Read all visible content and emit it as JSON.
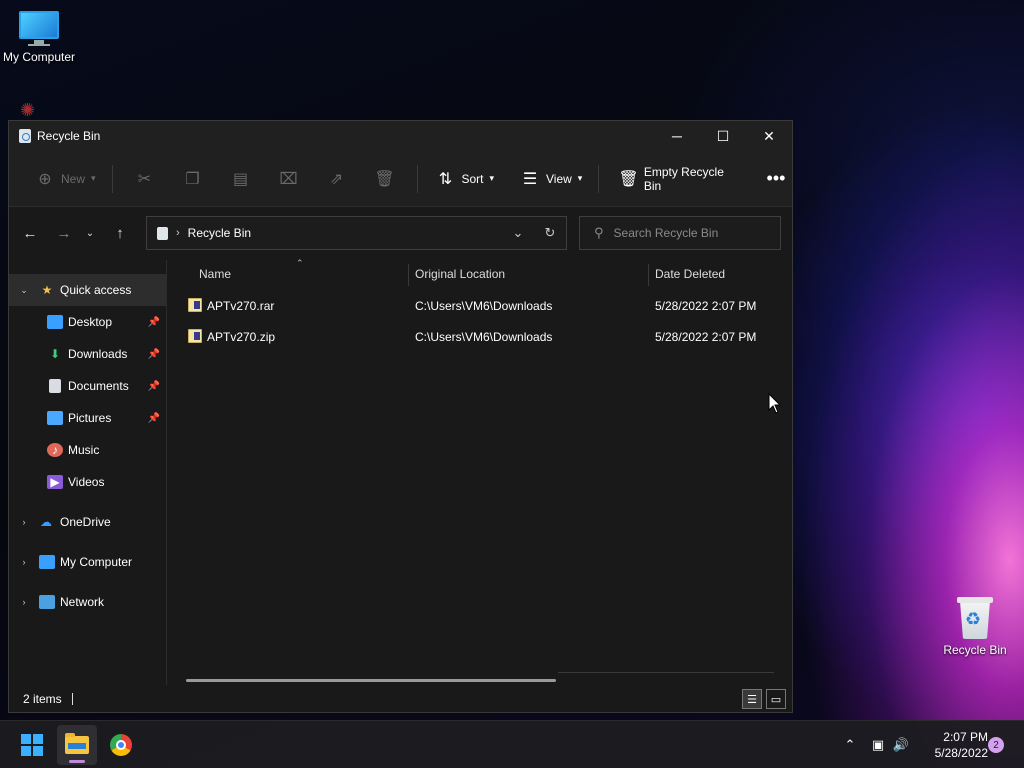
{
  "desktop": {
    "icons": [
      {
        "label": "My Computer"
      },
      {
        "label": "Recycle Bin"
      }
    ]
  },
  "window": {
    "title": "Recycle Bin",
    "toolbar": {
      "new_label": "New",
      "sort_label": "Sort",
      "view_label": "View",
      "empty_label": "Empty Recycle Bin"
    },
    "address": {
      "path": "Recycle Bin",
      "search_placeholder": "Search Recycle Bin"
    },
    "nav": {
      "quick_access": "Quick access",
      "items": [
        {
          "label": "Desktop",
          "pinned": true
        },
        {
          "label": "Downloads",
          "pinned": true
        },
        {
          "label": "Documents",
          "pinned": true
        },
        {
          "label": "Pictures",
          "pinned": true
        },
        {
          "label": "Music",
          "pinned": false
        },
        {
          "label": "Videos",
          "pinned": false
        }
      ],
      "onedrive": "OneDrive",
      "my_computer": "My Computer",
      "network": "Network"
    },
    "columns": {
      "name": "Name",
      "original_location": "Original Location",
      "date_deleted": "Date Deleted"
    },
    "files": [
      {
        "name": "APTv270.rar",
        "location": "C:\\Users\\VM6\\Downloads",
        "date": "5/28/2022 2:07 PM"
      },
      {
        "name": "APTv270.zip",
        "location": "C:\\Users\\VM6\\Downloads",
        "date": "5/28/2022 2:07 PM"
      }
    ],
    "status": {
      "count": "2 items"
    }
  },
  "taskbar": {
    "time": "2:07 PM",
    "date": "5/28/2022",
    "notifications": "2"
  },
  "colors": {
    "window_bg": "#191919",
    "accent": "#3ab0ff"
  }
}
